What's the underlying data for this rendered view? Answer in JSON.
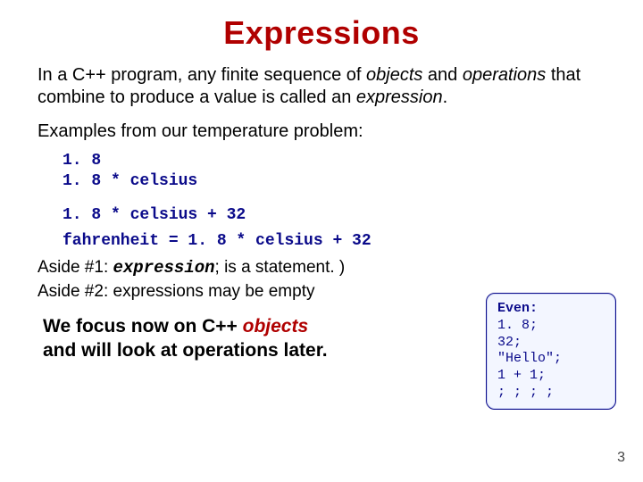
{
  "title": "Expressions",
  "intro": {
    "p1a": "In a C++ program, any finite sequence of ",
    "objects": "objects",
    "p1b": " and ",
    "operations": "operations",
    "p1c": " that combine to produce a value is called an ",
    "expression": "expression",
    "p1d": "."
  },
  "examples_label": "Examples from our temperature problem:",
  "code": {
    "l1": "1. 8",
    "l2": "1. 8 * celsius",
    "l3": "1. 8 * celsius + 32",
    "l4": "fahrenheit = 1. 8 * celsius + 32"
  },
  "asides": {
    "a1_pre": "Aside #1: ",
    "a1_expr": "expression",
    "a1_post": "; is a statement. )",
    "a2": "Aside #2: expressions may be empty"
  },
  "callout": {
    "header": "Even:",
    "l1": "1. 8;",
    "l2": "32;",
    "l3": "\"Hello\";",
    "l4": "1 + 1;",
    "l5": "; ; ; ;"
  },
  "focus": {
    "line1a": "We focus now on C++ ",
    "objects": "objects",
    "line2": "and will look at operations later."
  },
  "page_number": "3"
}
